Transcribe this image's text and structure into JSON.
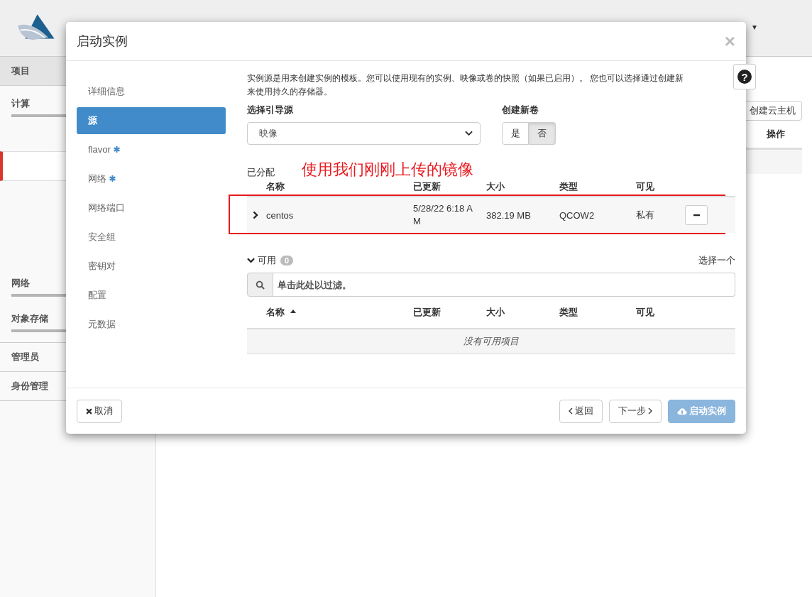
{
  "header": {
    "menu_caret": "▾"
  },
  "sidebar": {
    "items": [
      {
        "kind": "header",
        "label": "项目"
      },
      {
        "kind": "group",
        "label": "计算"
      },
      {
        "kind": "active"
      },
      {
        "kind": "group",
        "label": "网络"
      },
      {
        "kind": "group",
        "label": "对象存储"
      },
      {
        "kind": "link",
        "label": "管理员"
      },
      {
        "kind": "link",
        "label": "身份管理"
      }
    ]
  },
  "background": {
    "create_button": "创建云主机",
    "column_header": "操作"
  },
  "modal": {
    "title": "启动实例",
    "close": "×",
    "help": "?",
    "steps": [
      {
        "label": "详细信息",
        "required": false,
        "selected": false
      },
      {
        "label": "源",
        "required": false,
        "selected": true
      },
      {
        "label": "flavor",
        "required": true,
        "selected": false
      },
      {
        "label": "网络",
        "required": true,
        "selected": false
      },
      {
        "label": "网络端口",
        "required": false,
        "selected": false
      },
      {
        "label": "安全组",
        "required": false,
        "selected": false
      },
      {
        "label": "密钥对",
        "required": false,
        "selected": false
      },
      {
        "label": "配置",
        "required": false,
        "selected": false
      },
      {
        "label": "元数据",
        "required": false,
        "selected": false
      }
    ],
    "description": [
      "实例源是用来创建实例的模板。您可以使用现有的实例、映像或卷的快照（如果已启用）。 您也可以选择通过创建新",
      "来使用持久的存储器。"
    ],
    "boot_source": {
      "label": "选择引导源",
      "value": "映像"
    },
    "new_volume": {
      "label": "创建新卷",
      "options": [
        {
          "label": "是",
          "selected": false
        },
        {
          "label": "否",
          "selected": true
        }
      ]
    },
    "allocated": {
      "title": "已分配",
      "annotation": "使用我们刚刚上传的镜像",
      "columns": [
        "名称",
        "已更新",
        "大小",
        "类型",
        "可见"
      ],
      "rows": [
        {
          "cells": [
            "centos",
            "5/28/22 6:18 AM",
            "382.19 MB",
            "QCOW2",
            "私有"
          ]
        }
      ]
    },
    "available": {
      "title": "可用",
      "count": "0",
      "hint": "选择一个",
      "filter": {
        "placeholder": "单击此处以过滤。"
      },
      "columns": [
        {
          "label": "名称",
          "sorted": true
        },
        {
          "label": "已更新",
          "sorted": false
        },
        {
          "label": "大小",
          "sorted": false
        },
        {
          "label": "类型",
          "sorted": false
        },
        {
          "label": "可见",
          "sorted": false
        }
      ],
      "empty": "没有可用项目"
    },
    "footer": {
      "cancel": "取消",
      "back": "返回",
      "next": "下一步",
      "launch": {
        "label": "启动实例",
        "disabled": true
      }
    }
  }
}
